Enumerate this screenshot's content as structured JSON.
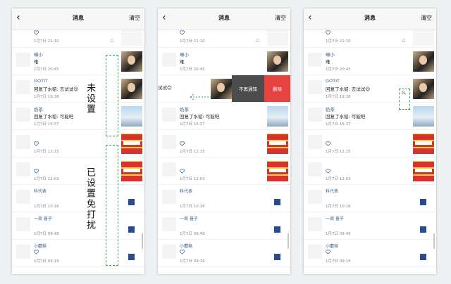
{
  "header": {
    "back": "‹",
    "title": "消息",
    "clear": "清空"
  },
  "rows": [
    {
      "name": "",
      "content": "",
      "time": "1月7日 21:10"
    },
    {
      "name": "琳小",
      "content": "难",
      "time": "1月7日 20:45"
    },
    {
      "name": "GOTIT",
      "content": "回复了水貂: 去试试😊",
      "time": "1月7日 19:38"
    },
    {
      "name": "奶茶",
      "content": "回复了水貂: 可能吧",
      "time": "1月7日 15:37"
    },
    {
      "name": "",
      "content": "",
      "time": "1月7日 12:15"
    },
    {
      "name": "",
      "content": "",
      "time": "1月7日 12:03"
    },
    {
      "name": "科代表",
      "content": "",
      "time": "1月7日 10:16"
    },
    {
      "name": "一周 普子",
      "content": "",
      "time": "1月7日 09:49"
    },
    {
      "name": "小蘑菇",
      "content": "",
      "time": "1月7日 09:19"
    }
  ],
  "swipe": {
    "partial_text": "试试😊",
    "mute": "不再通知",
    "delete": "删除"
  },
  "annotations": {
    "not_set": "未设置",
    "set_dnd": "已设置免打扰"
  },
  "colors": {
    "accent": "#2ea44f",
    "name_blue": "#3a5f8a",
    "delete_red": "#e64340",
    "mute_gray": "#4c4c4c"
  }
}
